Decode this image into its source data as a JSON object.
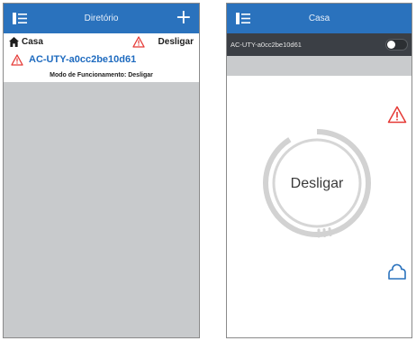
{
  "left_screen": {
    "nav_title": "Diretório",
    "home_label": "Casa",
    "status_label": "Desligar",
    "device_name": "AC-UTY-a0cc2be10d61",
    "mode_text": "Modo de Funcionamento: Desligar"
  },
  "right_screen": {
    "nav_title": "Casa",
    "device_name": "AC-UTY-a0cc2be10d61",
    "power_toggle_on": false,
    "dial_label": "Desligar"
  },
  "colors": {
    "navbar": "#2a72bd",
    "device_name_blue": "#1f6bbf",
    "warning_red": "#e53935",
    "grey_area": "#c8cacc",
    "dark_bar": "#3b3f45"
  },
  "icons": [
    "menu-icon",
    "plus-icon",
    "home-icon",
    "warning-icon",
    "cloud-icon"
  ]
}
